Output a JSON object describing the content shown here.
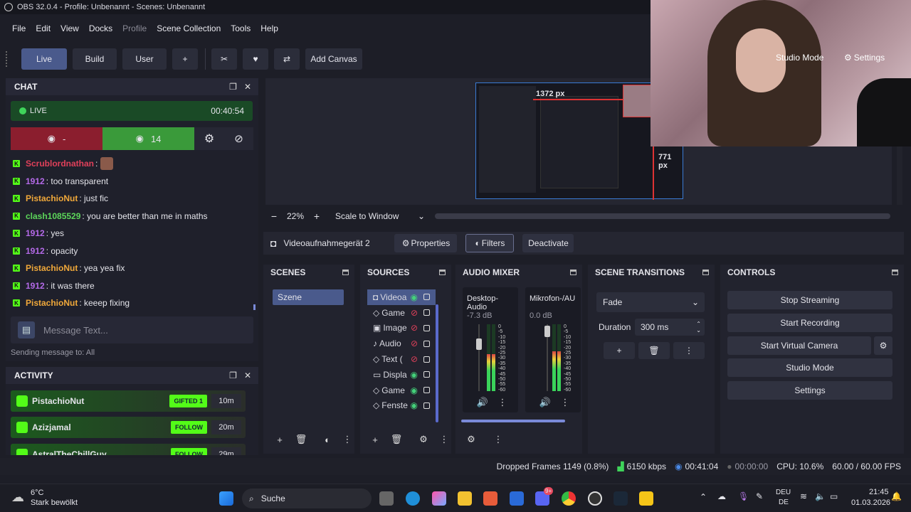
{
  "window": {
    "title": "OBS 32.0.4 - Profile: Unbenannt - Scenes: Unbenannt"
  },
  "menu": [
    "File",
    "Edit",
    "View",
    "Docks",
    "Profile",
    "Scene Collection",
    "Tools",
    "Help"
  ],
  "toolbar": {
    "live": "Live",
    "build": "Build",
    "user": "User",
    "plus": "+",
    "add_canvas": "Add Canvas",
    "studio_mode": "Studio Mode",
    "settings": "Settings"
  },
  "chat": {
    "title": "CHAT",
    "live_label": "LIVE",
    "live_time": "00:40:54",
    "viewers_a": "-",
    "viewers_b": "14",
    "messages": [
      {
        "user": "Scrublordnathan",
        "color": "#e0405a",
        "text": ":"
      },
      {
        "user": "1912",
        "color": "#b46ae8",
        "text": ": too transparent"
      },
      {
        "user": "PistachioNut",
        "color": "#f0a83a",
        "text": ": just fic"
      },
      {
        "user": "clash1085529",
        "color": "#5cd65a",
        "text": ": you are better than me in maths"
      },
      {
        "user": "1912",
        "color": "#b46ae8",
        "text": ": yes"
      },
      {
        "user": "1912",
        "color": "#b46ae8",
        "text": ": opacity"
      },
      {
        "user": "PistachioNut",
        "color": "#f0a83a",
        "text": ": yea yea fix"
      },
      {
        "user": "1912",
        "color": "#b46ae8",
        "text": ": it was there"
      },
      {
        "user": "PistachioNut",
        "color": "#f0a83a",
        "text": ": keeep fixing"
      }
    ],
    "input_placeholder": "Message Text...",
    "sending_to": "Sending message to: All"
  },
  "activity": {
    "title": "ACTIVITY",
    "items": [
      {
        "user": "PistachioNut",
        "tag": "GIFTED 1",
        "age": "10m"
      },
      {
        "user": "Azizjamal",
        "tag": "FOLLOW",
        "age": "20m"
      },
      {
        "user": "AstralTheChillGuy",
        "tag": "FOLLOW",
        "age": "29m"
      }
    ]
  },
  "preview": {
    "width_label": "1372 px",
    "height_label": "771 px"
  },
  "zoom": {
    "value": "22%",
    "minus": "−",
    "plus": "+",
    "scale_mode": "Scale to Window"
  },
  "source_bar": {
    "name": "Videoaufnahmegerät 2",
    "properties": "Properties",
    "filters": "Filters",
    "deactivate": "Deactivate"
  },
  "scenes": {
    "title": "SCENES",
    "items": [
      "Szene"
    ]
  },
  "sources": {
    "title": "SOURCES",
    "items": [
      {
        "name": "Videoa",
        "visible": true
      },
      {
        "name": "Game",
        "visible": false
      },
      {
        "name": "Image",
        "visible": false
      },
      {
        "name": "Audio",
        "visible": false
      },
      {
        "name": "Text (",
        "visible": false
      },
      {
        "name": "Displa",
        "visible": true
      },
      {
        "name": "Game",
        "visible": true
      },
      {
        "name": "Fenste",
        "visible": true
      }
    ]
  },
  "mixer": {
    "title": "AUDIO MIXER",
    "channels": [
      {
        "name": "Desktop-Audio",
        "db": "-7.3 dB",
        "level": 0.55
      },
      {
        "name": "Mikrofon-/AU",
        "db": "0.0 dB",
        "level": 0.6
      }
    ],
    "scale": [
      "0",
      "-5",
      "-10",
      "-15",
      "-20",
      "-25",
      "-30",
      "-35",
      "-40",
      "-45",
      "-50",
      "-55",
      "-60"
    ]
  },
  "transitions": {
    "title": "SCENE TRANSITIONS",
    "type": "Fade",
    "duration_label": "Duration",
    "duration": "300 ms"
  },
  "controls": {
    "title": "CONTROLS",
    "stop_streaming": "Stop Streaming",
    "start_recording": "Start Recording",
    "start_virtual_camera": "Start Virtual Camera",
    "studio_mode": "Studio Mode",
    "settings": "Settings"
  },
  "status": {
    "dropped": "Dropped Frames 1149 (0.8%)",
    "kbps": "6150 kbps",
    "stream_time": "00:41:04",
    "rec_time": "00:00:00",
    "cpu": "CPU: 10.6%",
    "fps": "60.00 / 60.00 FPS"
  },
  "taskbar": {
    "temp": "6°C",
    "weather": "Stark bewölkt",
    "search": "Suche",
    "lang1": "DEU",
    "lang2": "DE",
    "time": "21:45",
    "date": "01.03.2026",
    "badge": "9+"
  },
  "colors": {
    "accent": "#4a5a8c",
    "kick_green": "#53fc18",
    "live_green": "#1a4a26",
    "red_panel": "#8b1e2e",
    "green_panel": "#3a9a3a"
  }
}
